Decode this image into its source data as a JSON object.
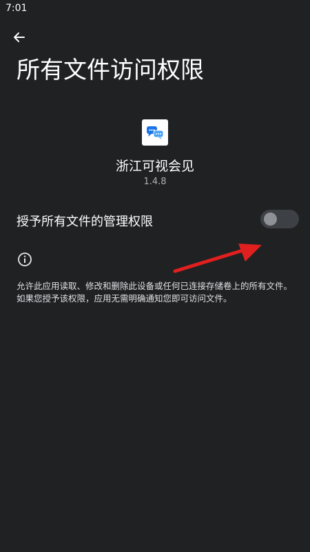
{
  "status_bar": {
    "time": "7:01"
  },
  "header": {
    "title": "所有文件访问权限"
  },
  "app": {
    "name": "浙江可视会见",
    "version": "1.4.8",
    "icon": "chat-bubbles-icon"
  },
  "permission": {
    "label": "授予所有文件的管理权限",
    "enabled": false
  },
  "info": {
    "description": "允许此应用读取、修改和删除此设备或任何已连接存储卷上的所有文件。如果您授予该权限，应用无需明确通知您即可访问文件。"
  },
  "colors": {
    "background": "#1f2123",
    "annotation_arrow": "#e0201f",
    "app_icon_accent": "#1a73e8"
  }
}
